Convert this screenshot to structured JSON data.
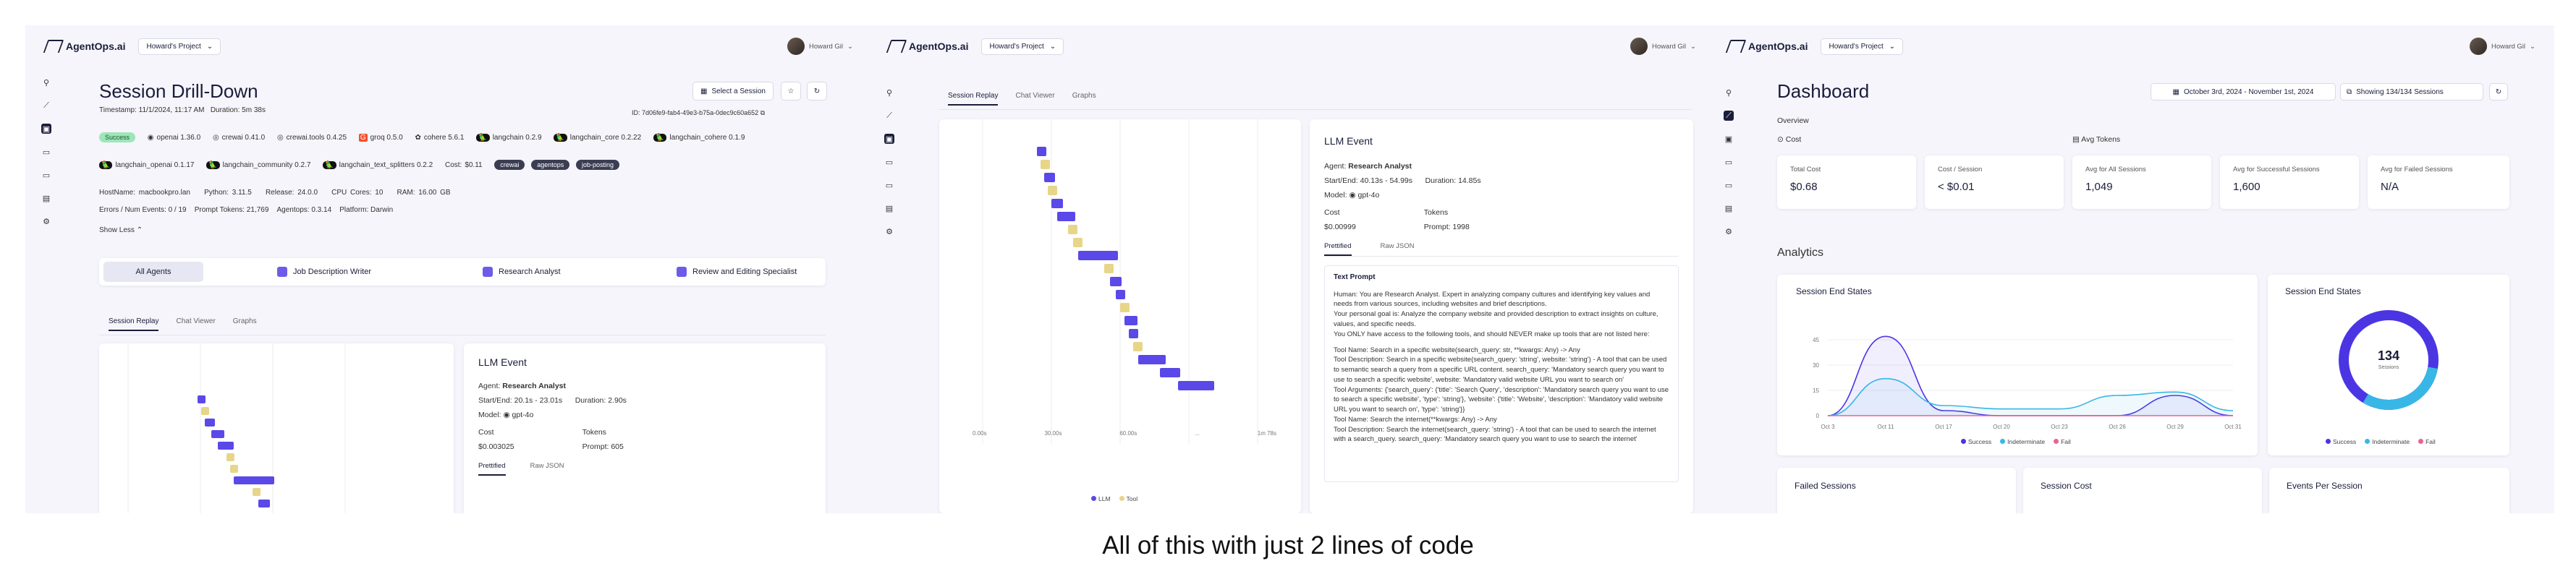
{
  "brand": {
    "name": "AgentOps.ai",
    "project": "Howard's Project",
    "user": "Howard Gil"
  },
  "colors": {
    "accent": "#5a48e8",
    "llm": "#5a48e8",
    "tool": "#e7d58a",
    "success": "#4b35e3",
    "indeterminate": "#38b7e6",
    "fail": "#f0628a"
  },
  "caption": "All of this with just 2 lines of code",
  "drill": {
    "title": "Session Drill-Down",
    "timestamp_label": "Timestamp:",
    "timestamp": "11/1/2024, 11:17 AM",
    "duration_label": "Duration:",
    "duration": "5m 38s",
    "id_label": "ID:",
    "id": "7d06fe9-fab4-49e3-b75a-0dec9c60a652",
    "select_session": "Select a Session",
    "status": "Success",
    "packages": [
      "openai 1.36.0",
      "crewai 0.41.0",
      "crewai.tools 0.4.25",
      "groq 0.5.0",
      "cohere 5.6.1",
      "langchain 0.2.9",
      "langchain_core 0.2.22",
      "langchain_cohere 0.1.9"
    ],
    "packages2": [
      "langchain_openai 0.1.17",
      "langchain_community 0.2.7",
      "langchain_text_splitters 0.2.2"
    ],
    "cost_label": "Cost:",
    "cost": "$0.11",
    "tags": [
      "crewai",
      "agentops",
      "job-posting"
    ],
    "host": "HostName: macbookpro.lan",
    "python": "Python: 3.11.5",
    "release": "Release: 24.0.0",
    "cpu": "CPU Cores: 10",
    "ram": "RAM: 16.00 GB",
    "errors": "Errors / Num Events: 0 / 19",
    "prompt_tokens": "Prompt Tokens: 21,769",
    "agentops": "Agentops: 0.3.14",
    "platform": "Platform: Darwin",
    "show_less": "Show Less",
    "agents": [
      "All Agents",
      "Job Description Writer",
      "Research Analyst",
      "Review and Editing Specialist"
    ],
    "tabs": [
      "Session Replay",
      "Chat Viewer",
      "Graphs"
    ],
    "event": {
      "title": "LLM Event",
      "agent_label": "Agent:",
      "agent": "Research Analyst",
      "start_label": "Start/End:",
      "start": "20.1s - 23.01s",
      "dur_label": "Duration:",
      "dur": "2.90s",
      "model_label": "Model:",
      "model": "gpt-4o",
      "cost_label": "Cost",
      "cost": "$0.003025",
      "tokens_label": "Tokens",
      "prompt_label": "Prompt:",
      "prompt": "605",
      "subtabs": [
        "Prettified",
        "Raw JSON"
      ]
    }
  },
  "replay": {
    "tabs": [
      "Session Replay",
      "Chat Viewer",
      "Graphs"
    ],
    "ticks": [
      "0.00s",
      "30.00s",
      "60.00s",
      "...",
      "1m 78s"
    ],
    "legend": [
      "LLM",
      "Tool"
    ],
    "event": {
      "title": "LLM Event",
      "agent_label": "Agent:",
      "agent": "Research Analyst",
      "start_label": "Start/End:",
      "start": "40.13s - 54.99s",
      "dur_label": "Duration:",
      "dur": "14.85s",
      "model_label": "Model:",
      "model": "gpt-4o",
      "cost_label": "Cost",
      "cost": "$0.00999",
      "tokens_label": "Tokens",
      "prompt_label": "Prompt:",
      "prompt": "1998",
      "subtabs": [
        "Prettified",
        "Raw JSON"
      ],
      "text_prompt_label": "Text Prompt",
      "prompt_lines": [
        "Human: You are Research Analyst. Expert in analyzing company cultures and identifying key values and needs from various sources, including websites and brief descriptions.",
        "Your personal goal is: Analyze the company website and provided description to extract insights on culture, values, and specific needs.",
        "You ONLY have access to the following tools, and should NEVER make up tools that are not listed here:",
        "",
        "Tool Name: Search in a specific website(search_query: str, **kwargs: Any) -> Any",
        "Tool Description: Search in a specific website(search_query: 'string', website: 'string') - A tool that can be used to semantic search a query from a specific URL content. search_query: 'Mandatory search query you want to use to search a specific website', website: 'Mandatory valid website URL you want to search on'",
        "Tool Arguments: {'search_query': {'title': 'Search Query', 'description': 'Mandatory search query you want to use to search a specific website', 'type': 'string'}, 'website': {'title': 'Website', 'description': 'Mandatory valid website URL you want to search on', 'type': 'string'}}",
        "Tool Name: Search the internet(**kwargs: Any) -> Any",
        "Tool Description: Search the internet(search_query: 'string') - A tool that can be used to search the internet with a search_query. search_query: 'Mandatory search query you want to use to search the internet'"
      ]
    }
  },
  "dashboard": {
    "title": "Dashboard",
    "date_range": "October 3rd, 2024 - November 1st, 2024",
    "showing": "Showing 134/134 Sessions",
    "overview": "Overview",
    "cost_tab": "Cost",
    "tokens_tab": "Avg Tokens",
    "stats": [
      {
        "label": "Total Cost",
        "value": "$0.68"
      },
      {
        "label": "Cost / Session",
        "value": "< $0.01"
      },
      {
        "label": "Avg for All Sessions",
        "value": "1,049"
      },
      {
        "label": "Avg for Successful Sessions",
        "value": "1,600"
      },
      {
        "label": "Avg for Failed Sessions",
        "value": "N/A"
      }
    ],
    "analytics": "Analytics",
    "end_states_title": "Session End States",
    "donut_value": "134",
    "donut_label": "Sessions",
    "legend": [
      "Success",
      "Indeterminate",
      "Fail"
    ],
    "bottom_cards": [
      "Failed Sessions",
      "Session Cost",
      "Events Per Session"
    ]
  },
  "chart_data": {
    "type": "line",
    "title": "Session End States",
    "x": [
      "Oct 3",
      "Oct 11",
      "Oct 17",
      "Oct 20",
      "Oct 23",
      "Oct 26",
      "Oct 29",
      "Oct 31"
    ],
    "ylim": [
      0,
      60
    ],
    "yticks": [
      "0",
      "15",
      "30",
      "45"
    ],
    "series": [
      {
        "name": "Success",
        "values": [
          0,
          47,
          3,
          0,
          0,
          0,
          12,
          0
        ]
      },
      {
        "name": "Indeterminate",
        "values": [
          0,
          22,
          6,
          4,
          4,
          12,
          14,
          3
        ]
      },
      {
        "name": "Fail",
        "values": [
          0,
          0,
          0,
          0,
          0,
          0,
          0,
          0
        ]
      }
    ],
    "legend": "bottom"
  }
}
